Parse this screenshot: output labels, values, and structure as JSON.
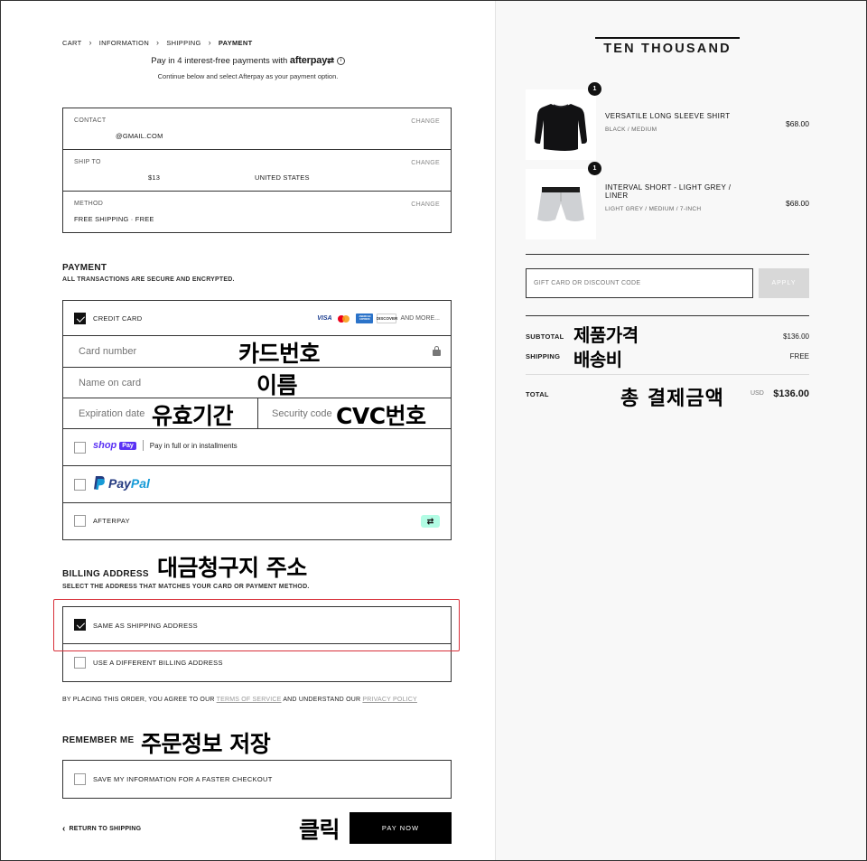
{
  "breadcrumb": [
    "CART",
    "INFORMATION",
    "SHIPPING",
    "PAYMENT"
  ],
  "afterpay": {
    "line_prefix": "Pay in 4 interest-free payments with",
    "logo": "afterpay",
    "info": "i",
    "subline": "Continue below and select Afterpay as your payment option."
  },
  "summary": {
    "contact_label": "CONTACT",
    "contact_value": "@GMAIL.COM",
    "ship_label": "SHIP TO",
    "ship_value": "$13",
    "ship_country": "UNITED STATES",
    "method_label": "METHOD",
    "method_value": "FREE SHIPPING · FREE",
    "change": "CHANGE"
  },
  "payment": {
    "heading": "PAYMENT",
    "sub": "ALL TRANSACTIONS ARE SECURE AND ENCRYPTED.",
    "credit_card": "CREDIT CARD",
    "card_logos": [
      "VISA",
      "AMERICAN EXPRESS",
      "DISCOVER"
    ],
    "and_more": "AND MORE...",
    "card_number_placeholder": "Card number",
    "name_placeholder": "Name on card",
    "expiry_placeholder": "Expiration date",
    "security_placeholder": "Security code",
    "shoppay_shop": "shop",
    "shoppay_pay": "Pay",
    "shoppay_text": "Pay in full or in installments",
    "paypal_a": "Pay",
    "paypal_b": "Pal",
    "afterpay": "AFTERPAY"
  },
  "billing": {
    "heading": "BILLING ADDRESS",
    "sub": "SELECT THE ADDRESS THAT MATCHES YOUR CARD OR PAYMENT METHOD.",
    "same": "SAME AS SHIPPING ADDRESS",
    "different": "USE A DIFFERENT BILLING ADDRESS"
  },
  "terms": {
    "part1": "BY PLACING THIS ORDER, YOU AGREE TO OUR",
    "tos": "TERMS OF SERVICE",
    "part2": "AND UNDERSTAND OUR",
    "privacy": "PRIVACY POLICY"
  },
  "remember": {
    "heading": "REMEMBER ME",
    "save": "SAVE MY INFORMATION FOR A FASTER CHECKOUT"
  },
  "footer": {
    "return": "RETURN TO SHIPPING",
    "pay_now": "PAY NOW"
  },
  "annotations": {
    "card_number": "카드번호",
    "name": "이름",
    "expiry": "유효기간",
    "cvc": "CVC번호",
    "billing": "대금청구지 주소",
    "remember": "주문정보 저장",
    "click": "클릭",
    "product_price": "제품가격",
    "shipping_fee": "배송비",
    "total": "총 결제금액"
  },
  "order": {
    "brand": "TEN THOUSAND",
    "items": [
      {
        "qty": "1",
        "name": "VERSATILE LONG SLEEVE SHIRT",
        "variant": "BLACK / MEDIUM",
        "price": "$68.00"
      },
      {
        "qty": "1",
        "name": "INTERVAL SHORT - LIGHT GREY / LINER",
        "variant": "LIGHT GREY / MEDIUM / 7-INCH",
        "price": "$68.00"
      }
    ],
    "gift_placeholder": "GIFT CARD OR DISCOUNT CODE",
    "apply": "APPLY",
    "subtotal_label": "SUBTOTAL",
    "subtotal_value": "$136.00",
    "shipping_label": "SHIPPING",
    "shipping_value": "FREE",
    "total_label": "TOTAL",
    "currency": "USD",
    "total_value": "$136.00"
  },
  "colors": {
    "accent_red": "#d8303a",
    "shoppay_purple": "#5a31f4",
    "paypal_dark": "#253b80",
    "paypal_light": "#179bd7",
    "afterpay_mint": "#b2fce4"
  }
}
